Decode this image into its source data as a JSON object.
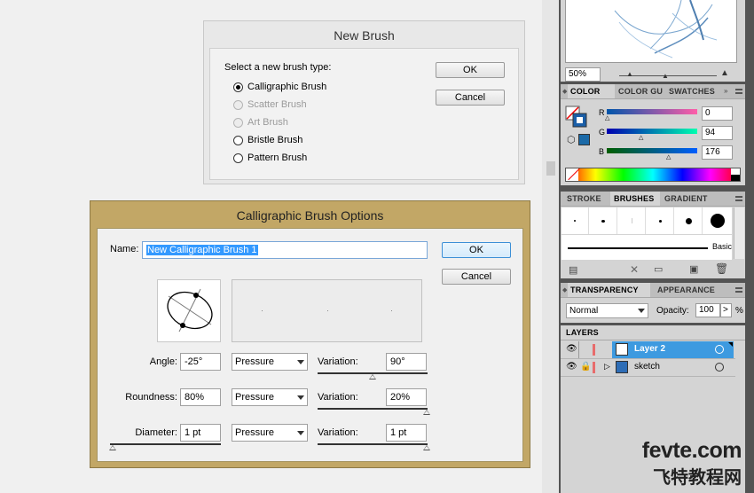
{
  "new_brush": {
    "title": "New Brush",
    "prompt": "Select a new brush type:",
    "options": [
      {
        "label": "Calligraphic Brush",
        "checked": true,
        "disabled": false
      },
      {
        "label": "Scatter Brush",
        "checked": false,
        "disabled": true
      },
      {
        "label": "Art Brush",
        "checked": false,
        "disabled": true
      },
      {
        "label": "Bristle Brush",
        "checked": false,
        "disabled": false
      },
      {
        "label": "Pattern Brush",
        "checked": false,
        "disabled": false
      }
    ],
    "ok_label": "OK",
    "cancel_label": "Cancel"
  },
  "calligraphic": {
    "title": "Calligraphic Brush Options",
    "name_label": "Name:",
    "name_value": "New Calligraphic Brush 1",
    "ok_label": "OK",
    "cancel_label": "Cancel",
    "angle": {
      "label": "Angle:",
      "value": "-25°",
      "mode": "Pressure",
      "variation_label": "Variation:",
      "variation": "90°",
      "variation_level": 0.5
    },
    "roundness": {
      "label": "Roundness:",
      "value": "80%",
      "mode": "Pressure",
      "variation_label": "Variation:",
      "variation": "20%",
      "variation_level": 1.0
    },
    "diameter": {
      "label": "Diameter:",
      "value": "1 pt",
      "mode": "Pressure",
      "variation_label": "Variation:",
      "variation": "1 pt",
      "variation_level": 1.0,
      "diameter_level": 0.0
    }
  },
  "panels": {
    "navigator": {
      "zoom": "50%"
    },
    "color": {
      "tabs": [
        "COLOR",
        "COLOR GU",
        "SWATCHES"
      ],
      "channels": [
        {
          "label": "R",
          "value": "0",
          "level": 0.0
        },
        {
          "label": "G",
          "value": "94",
          "level": 0.37
        },
        {
          "label": "B",
          "value": "176",
          "level": 0.69
        }
      ],
      "fill_color": "#005eb0"
    },
    "brushes": {
      "tabs": [
        "STROKE",
        "BRUSHES",
        "GRADIENT"
      ],
      "basic_label": "Basic"
    },
    "transparency": {
      "tabs": [
        "TRANSPARENCY",
        "APPEARANCE"
      ],
      "blend_mode": "Normal",
      "opacity_label": "Opacity:",
      "opacity_value": "100",
      "percent": "%"
    },
    "layers": {
      "tab": "LAYERS",
      "items": [
        {
          "name": "Layer 2",
          "selected": true
        },
        {
          "name": "sketch",
          "selected": false
        }
      ]
    }
  },
  "watermark": {
    "en": "fevte.com",
    "cn": "飞特教程网"
  }
}
